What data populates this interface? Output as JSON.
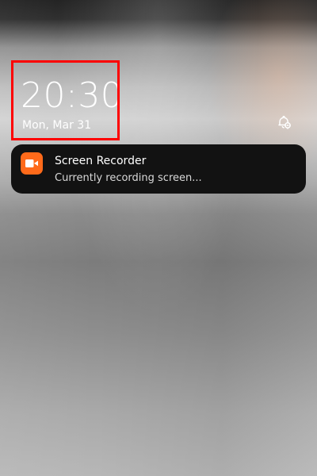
{
  "lockscreen": {
    "time": "20:30",
    "date": "Mon, Mar 31"
  },
  "icons": {
    "notification_settings": "bell-settings-icon",
    "recorder_app": "video-camera-icon"
  },
  "notification": {
    "app_name": "Screen Recorder",
    "message": "Currently recording screen..."
  },
  "colors": {
    "highlight": "#ff0000",
    "app_icon_bg": "#ff6a1a",
    "notification_bg": "#121212"
  }
}
